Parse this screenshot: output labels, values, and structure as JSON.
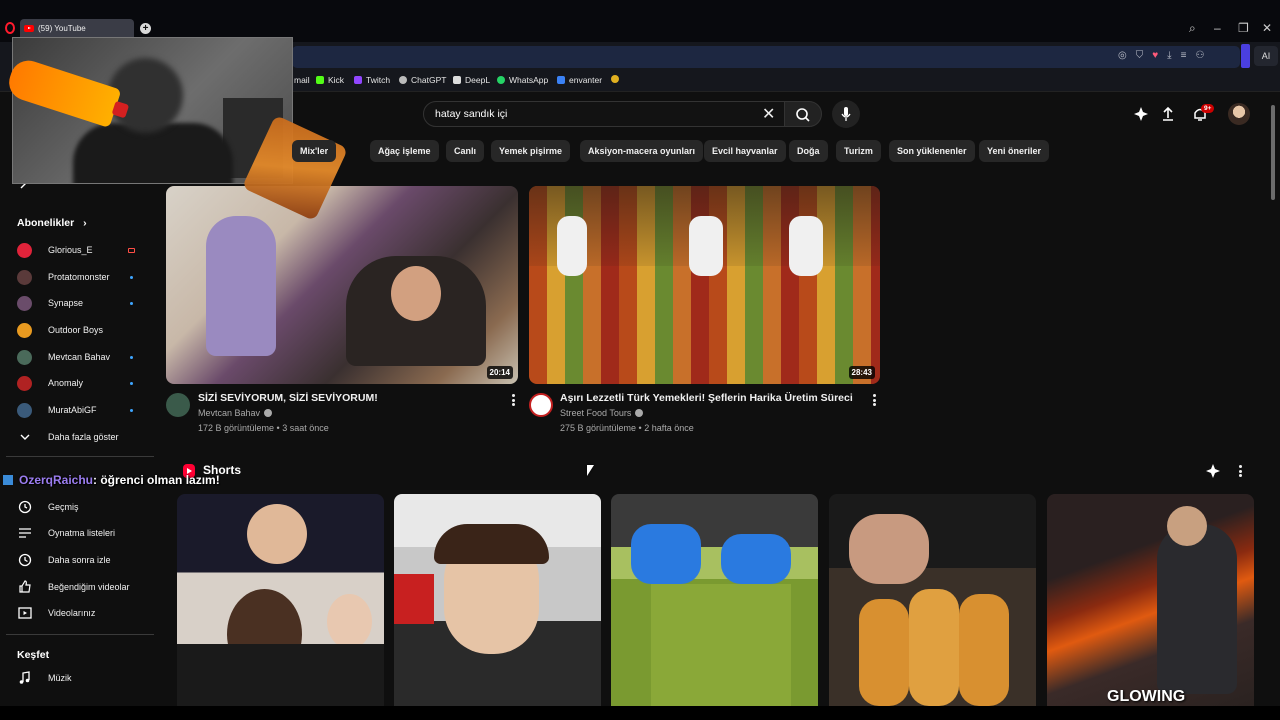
{
  "browser": {
    "tab_title": "(59) YouTube",
    "ai_label": "AI",
    "bookmarks": [
      "mail",
      "Kick",
      "Twitch",
      "ChatGPT",
      "DeepL",
      "WhatsApp",
      "envanter"
    ]
  },
  "header": {
    "search_value": "hatay sandık içi",
    "notification_badge": "9+"
  },
  "chips": [
    "Mix'ler",
    "Ağaç işleme",
    "Canlı",
    "Yemek pişirme",
    "Aksiyon-macera oyunları",
    "Evcil hayvanlar",
    "Doğa",
    "Turizm",
    "Son yüklenenler",
    "Yeni öneriler"
  ],
  "sidebar": {
    "subscriptions_heading": "Abonelikler",
    "subscriptions": [
      {
        "label": "Glorious_E"
      },
      {
        "label": "Protatomonster"
      },
      {
        "label": "Synapse"
      },
      {
        "label": "Outdoor Boys"
      },
      {
        "label": "Mevtcan Bahav"
      },
      {
        "label": "Anomaly"
      },
      {
        "label": "MuratAbiGF"
      }
    ],
    "show_more": "Daha fazla göster",
    "you_items": [
      "Geçmiş",
      "Oynatma listeleri",
      "Daha sonra izle",
      "Beğendiğim videolar",
      "Videolarınız"
    ],
    "explore_heading": "Keşfet",
    "explore_items": [
      "Müzik"
    ]
  },
  "chat_overlay": {
    "username": "OzerqRaichu",
    "message": ": öğrenci olman lazım!"
  },
  "videos": [
    {
      "title": "SİZİ SEVİYORUM, SİZİ SEVİYORUM!",
      "channel": "Mevtcan Bahav",
      "meta": "172 B görüntüleme • 3 saat önce",
      "duration": "20:14"
    },
    {
      "title": "Aşırı Lezzetli Türk Yemekleri! Şeflerin Harika Üretim Süreci",
      "channel": "Street Food Tours",
      "meta": "275 B görüntüleme • 2 hafta önce",
      "duration": "28:43"
    }
  ],
  "shorts": {
    "heading": "Shorts",
    "last_caption": "GLOWING"
  },
  "colors": {
    "background": "#0f0f0f",
    "chip": "#272727",
    "accent_red": "#ff0000",
    "text_secondary": "#aaaaaa"
  }
}
